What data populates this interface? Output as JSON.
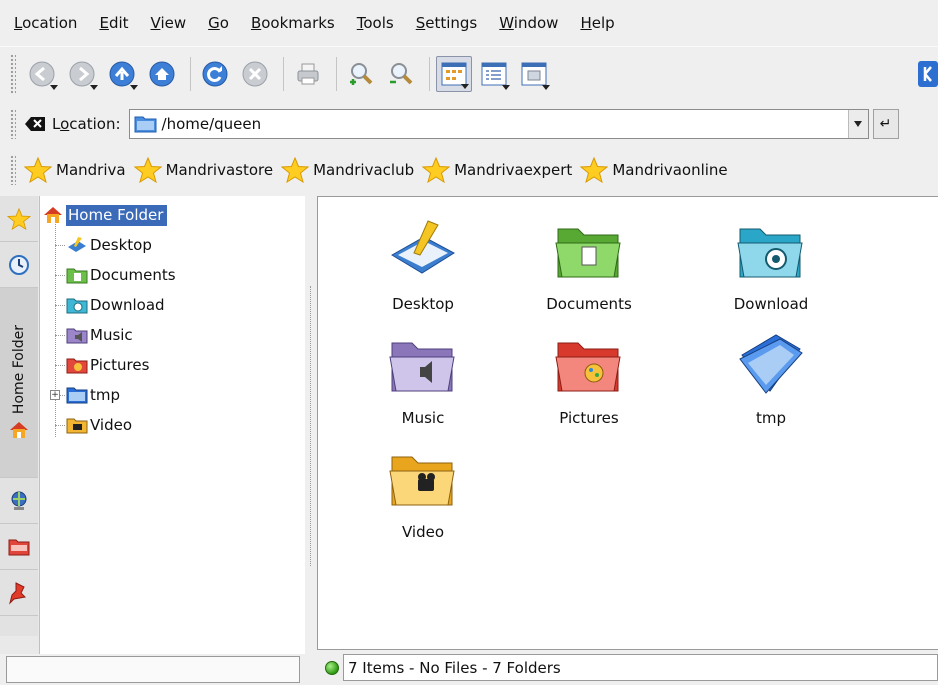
{
  "menu": {
    "items": [
      {
        "label": "Location",
        "accel": "L",
        "rest": "ocation"
      },
      {
        "label": "Edit",
        "accel": "E",
        "rest": "dit"
      },
      {
        "label": "View",
        "accel": "V",
        "rest": "iew"
      },
      {
        "label": "Go",
        "accel": "G",
        "rest": "o"
      },
      {
        "label": "Bookmarks",
        "accel": "B",
        "rest": "ookmarks"
      },
      {
        "label": "Tools",
        "accel": "T",
        "rest": "ools"
      },
      {
        "label": "Settings",
        "accel": "S",
        "rest": "ettings"
      },
      {
        "label": "Window",
        "accel": "W",
        "rest": "indow"
      },
      {
        "label": "Help",
        "accel": "H",
        "rest": "elp"
      }
    ]
  },
  "toolbar": {
    "icons": [
      "back-icon",
      "forward-icon",
      "up-icon",
      "home-icon",
      "reload-icon",
      "stop-icon",
      "print-icon",
      "zoom-in-icon",
      "zoom-out-icon",
      "icon-view-icon",
      "detail-view-icon",
      "preview-icon"
    ]
  },
  "location": {
    "label_pre": "L",
    "label_accel": "o",
    "label_post": "cation:",
    "value": "/home/queen"
  },
  "bookmarks": [
    "Mandriva",
    "Mandrivastore",
    "Mandrivaclub",
    "Mandrivaexpert",
    "Mandrivaonline"
  ],
  "sidebar": {
    "active_tab_label": "Home Folder"
  },
  "tree": {
    "root": "Home Folder",
    "children": [
      "Desktop",
      "Documents",
      "Download",
      "Music",
      "Pictures",
      "tmp",
      "Video"
    ]
  },
  "icons": {
    "items": [
      {
        "name": "Desktop",
        "icon": "desktop-folder-icon",
        "color": "#3b7ed0"
      },
      {
        "name": "Documents",
        "icon": "documents-folder-icon",
        "color": "#6cc04a"
      },
      {
        "name": "Download",
        "icon": "download-folder-icon",
        "color": "#3fb8d6"
      },
      {
        "name": "Music",
        "icon": "music-folder-icon",
        "color": "#9a86c8"
      },
      {
        "name": "Pictures",
        "icon": "pictures-folder-icon",
        "color": "#e2483c"
      },
      {
        "name": "tmp",
        "icon": "blue-folder-icon",
        "color": "#2a6fd8"
      },
      {
        "name": "Video",
        "icon": "video-folder-icon",
        "color": "#f2b632"
      }
    ]
  },
  "status": {
    "text": "7 Items - No Files - 7 Folders"
  }
}
